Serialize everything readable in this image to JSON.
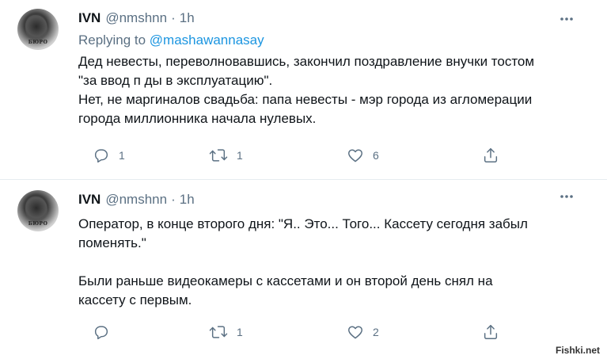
{
  "tweets": [
    {
      "author_name": "IVN",
      "author_handle": "@nmshnn",
      "separator": "·",
      "time": "1h",
      "avatar_text": "БЮРО",
      "reply_prefix": "Replying to",
      "reply_to": "@mashawannasay",
      "lines": [
        "Дед невесты, переволновавшись, закончил поздравление внучки тостом",
        "\"за ввод п  ды в эксплуатацию\".",
        "Нет, не маргиналов свадьба: папа невесты - мэр города из агломерации",
        "города миллионника начала нулевых."
      ],
      "reply_count": "1",
      "retweet_count": "1",
      "like_count": "6"
    },
    {
      "author_name": "IVN",
      "author_handle": "@nmshnn",
      "separator": "·",
      "time": "1h",
      "avatar_text": "БЮРО",
      "lines": [
        "Оператор, в конце второго дня: \"Я.. Это... Того... Кассету сегодня забыл",
        "поменять.\"",
        "",
        "Были раньше видеокамеры с кассетами и он второй день снял на",
        "кассету с первым."
      ],
      "reply_count": "",
      "retweet_count": "1",
      "like_count": "2"
    }
  ],
  "watermark": "Fishki.net",
  "icons": {
    "more": "more-horizontal-icon",
    "reply": "reply-icon",
    "retweet": "retweet-icon",
    "like": "heart-icon",
    "share": "share-icon"
  },
  "colors": {
    "text": "#0f1419",
    "secondary": "#5b7083",
    "link": "#1b95e0",
    "divider": "#e6ecf0"
  }
}
